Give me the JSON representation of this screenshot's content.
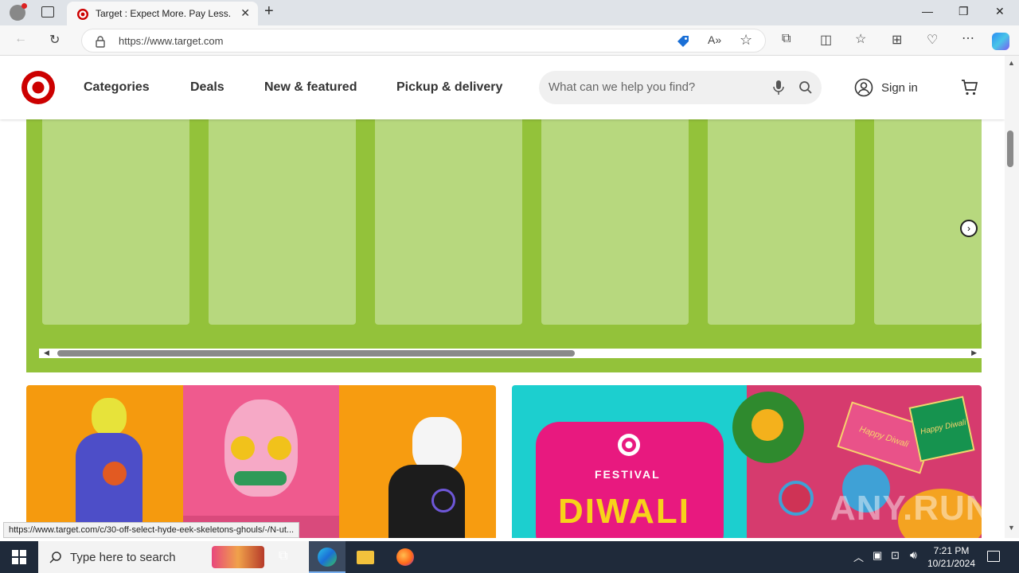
{
  "browser": {
    "tab_title": "Target : Expect More. Pay Less.",
    "new_tab": "+",
    "url": "https://www.target.com",
    "window_controls": {
      "minimize": "—",
      "restore": "❐",
      "close": "✕"
    }
  },
  "header": {
    "nav": [
      "Categories",
      "Deals",
      "New & featured",
      "Pickup & delivery"
    ],
    "search_placeholder": "What can we help you find?",
    "signin": "Sign in"
  },
  "promo_right": {
    "festival": "FESTIVAL",
    "diwali": "DIWALI",
    "watermark": "ANY.RUN",
    "card_text_1": "Happy Diwali",
    "card_text_2": "Happy Diwali"
  },
  "status_link": "https://www.target.com/c/30-off-select-hyde-eek-skeletons-ghouls/-/N-ut...",
  "taskbar": {
    "search_text": "Type here to search",
    "time": "7:21 PM",
    "date": "10/21/2024"
  },
  "colors": {
    "target_red": "#cc0000",
    "band_green": "#93c23a",
    "card_green": "#b7d87e"
  }
}
